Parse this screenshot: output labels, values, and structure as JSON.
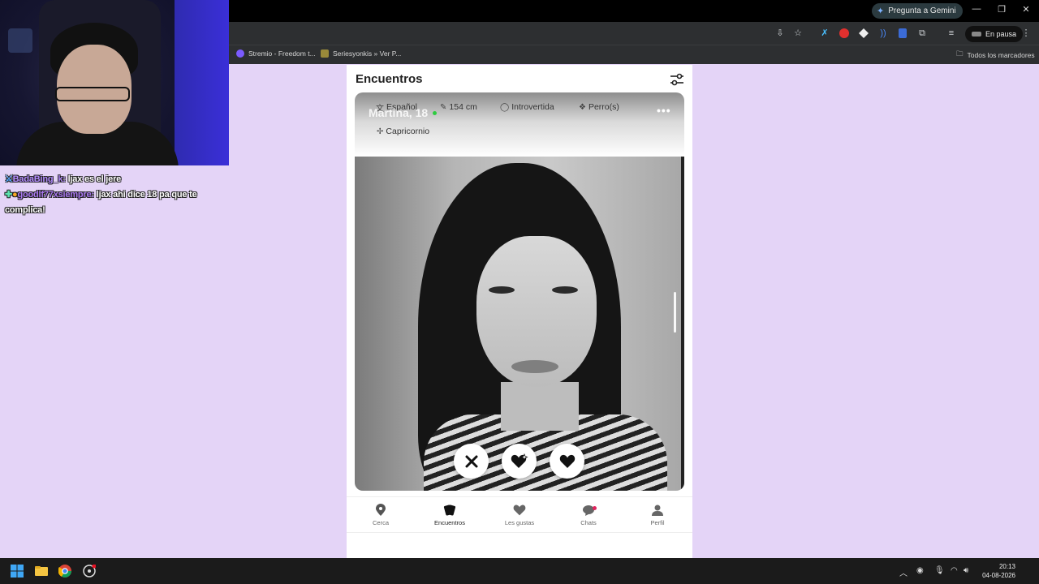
{
  "browser": {
    "gemini_label": "Pregunta a Gemini",
    "pause_label": "En pausa",
    "bookmarks": [
      {
        "label": "Stremio - Freedom t...",
        "color": "#7b5bff"
      },
      {
        "label": "Seriesyonkis » Ver P...",
        "color": "#9a8a3a"
      }
    ],
    "all_bookmarks_label": "Todos los marcadores"
  },
  "chat": {
    "messages": [
      {
        "user": "BadaBing_k:",
        "text": " ljax es el jere"
      },
      {
        "user": "goodlf77xsiempre:",
        "text": " ljax ahi dice 18 pa que te complica!"
      }
    ]
  },
  "app": {
    "title": "Encuentros",
    "profile": {
      "name": "Martina, 18",
      "chips": [
        "Español",
        "154 cm",
        "Introvertida",
        "Perro(s)",
        "Capricornio"
      ]
    },
    "nav": [
      {
        "label": "Cerca",
        "icon": "location-pin-icon"
      },
      {
        "label": "Encuentros",
        "icon": "cards-icon"
      },
      {
        "label": "Les gustas",
        "icon": "heart-icon"
      },
      {
        "label": "Chats",
        "icon": "chat-bubble-icon"
      },
      {
        "label": "Perfil",
        "icon": "person-icon"
      }
    ]
  },
  "taskbar": {
    "time": "20:13",
    "date": "04-08-2026"
  }
}
